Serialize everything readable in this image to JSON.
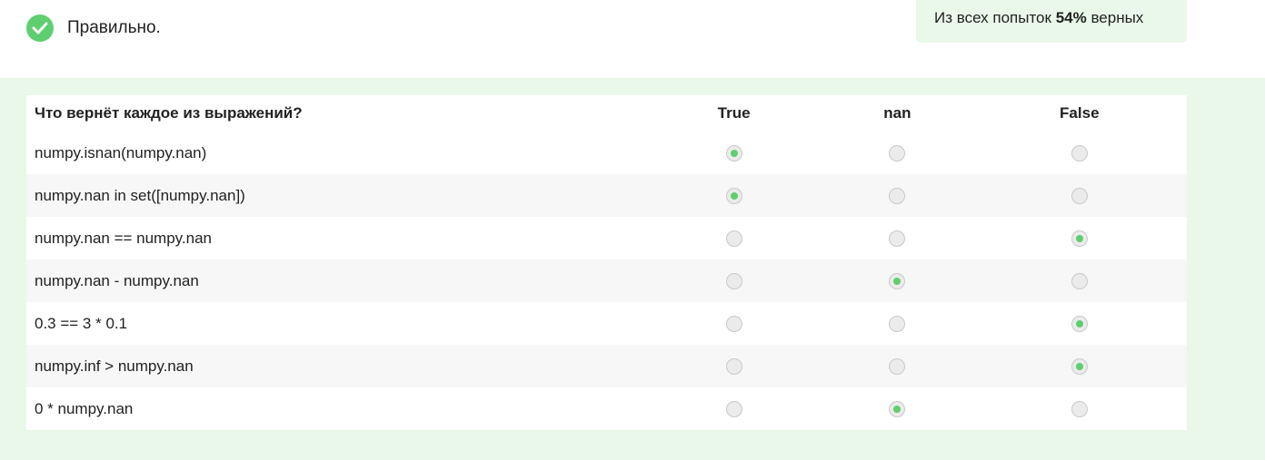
{
  "result": {
    "icon": "check-circle-icon",
    "text": "Правильно."
  },
  "stats": {
    "prefix": "Из всех попыток ",
    "percent": "54%",
    "suffix": " верных"
  },
  "matrix": {
    "question": "Что вернёт каждое из выражений?",
    "options": [
      "True",
      "nan",
      "False"
    ],
    "rows": [
      {
        "expr": "numpy.isnan(numpy.nan)",
        "selected": 0
      },
      {
        "expr": "numpy.nan in set([numpy.nan])",
        "selected": 0
      },
      {
        "expr": "numpy.nan == numpy.nan",
        "selected": 2
      },
      {
        "expr": "numpy.nan - numpy.nan",
        "selected": 1
      },
      {
        "expr": "0.3 == 3 * 0.1",
        "selected": 2
      },
      {
        "expr": "numpy.inf > numpy.nan",
        "selected": 2
      },
      {
        "expr": "0 * numpy.nan",
        "selected": 1
      }
    ]
  },
  "colors": {
    "accent": "#5dcf6e",
    "panel_bg": "#e9f8e9"
  }
}
